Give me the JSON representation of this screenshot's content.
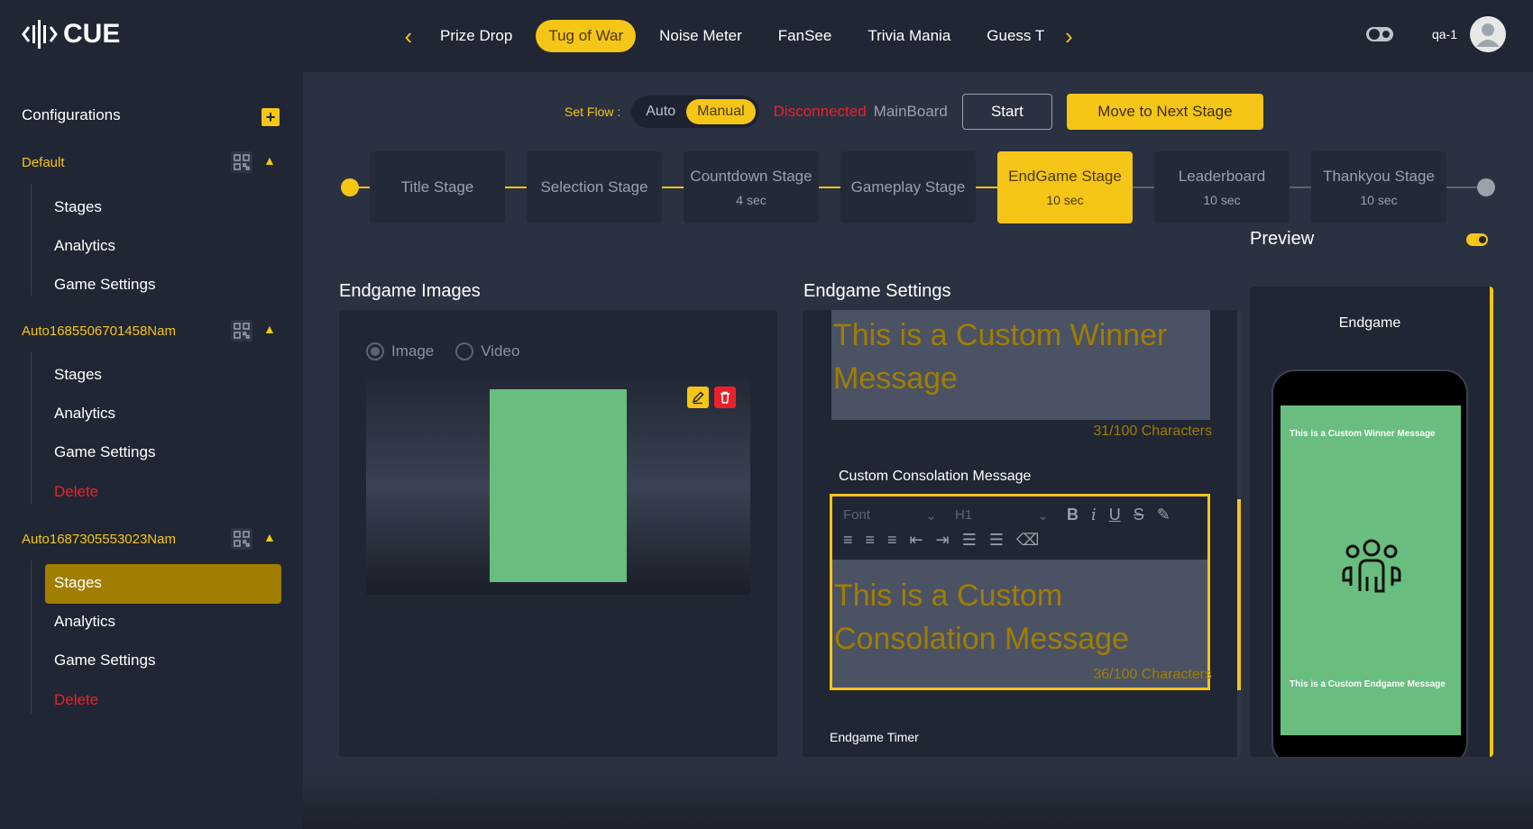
{
  "brand": {
    "name": "CUE"
  },
  "tabs": {
    "items": [
      "Prize Drop",
      "Tug of War",
      "Noise Meter",
      "FanSee",
      "Trivia Mania",
      "Guess T"
    ],
    "active": "Tug of War"
  },
  "user": {
    "name": "qa-1"
  },
  "sidebar": {
    "heading": "Configurations",
    "configs": [
      {
        "name": "Default",
        "items": [
          "Stages",
          "Analytics",
          "Game Settings"
        ]
      },
      {
        "name": "Auto1685506701458Nam",
        "items": [
          "Stages",
          "Analytics",
          "Game Settings",
          "Delete"
        ]
      },
      {
        "name": "Auto1687305553023Nam",
        "items": [
          "Stages",
          "Analytics",
          "Game Settings",
          "Delete"
        ],
        "active_item": "Stages"
      }
    ]
  },
  "flow": {
    "label": "Set Flow :",
    "options": [
      "Auto",
      "Manual"
    ],
    "selected": "Manual",
    "status": "Disconnected",
    "board": "MainBoard",
    "start_label": "Start",
    "next_label": "Move to Next Stage"
  },
  "stages": [
    {
      "name": "Title Stage",
      "duration": ""
    },
    {
      "name": "Selection Stage",
      "duration": ""
    },
    {
      "name": "Countdown Stage",
      "duration": "4 sec"
    },
    {
      "name": "Gameplay Stage",
      "duration": ""
    },
    {
      "name": "EndGame Stage",
      "duration": "10 sec",
      "active": true
    },
    {
      "name": "Leaderboard",
      "duration": "10 sec"
    },
    {
      "name": "Thankyou Stage",
      "duration": "10 sec"
    }
  ],
  "images": {
    "title": "Endgame Images",
    "radio_image": "Image",
    "radio_video": "Video"
  },
  "settings": {
    "title": "Endgame Settings",
    "winner_message": "This is a Custom Winner Message",
    "winner_count": "31/100 Characters",
    "consolation_label": "Custom Consolation Message",
    "font_placeholder": "Font",
    "heading_placeholder": "H1",
    "consolation_message": "This is a Custom Consolation Message",
    "consolation_count": "36/100 Characters",
    "timer_label": "Endgame Timer"
  },
  "preview": {
    "title": "Preview",
    "screen_label": "Endgame",
    "winner_text": "This is a Custom Winner Message",
    "endgame_text": "This is a Custom Endgame Message"
  },
  "colors": {
    "accent": "#f5c518",
    "danger": "#e8222b",
    "green": "#69be7f"
  }
}
